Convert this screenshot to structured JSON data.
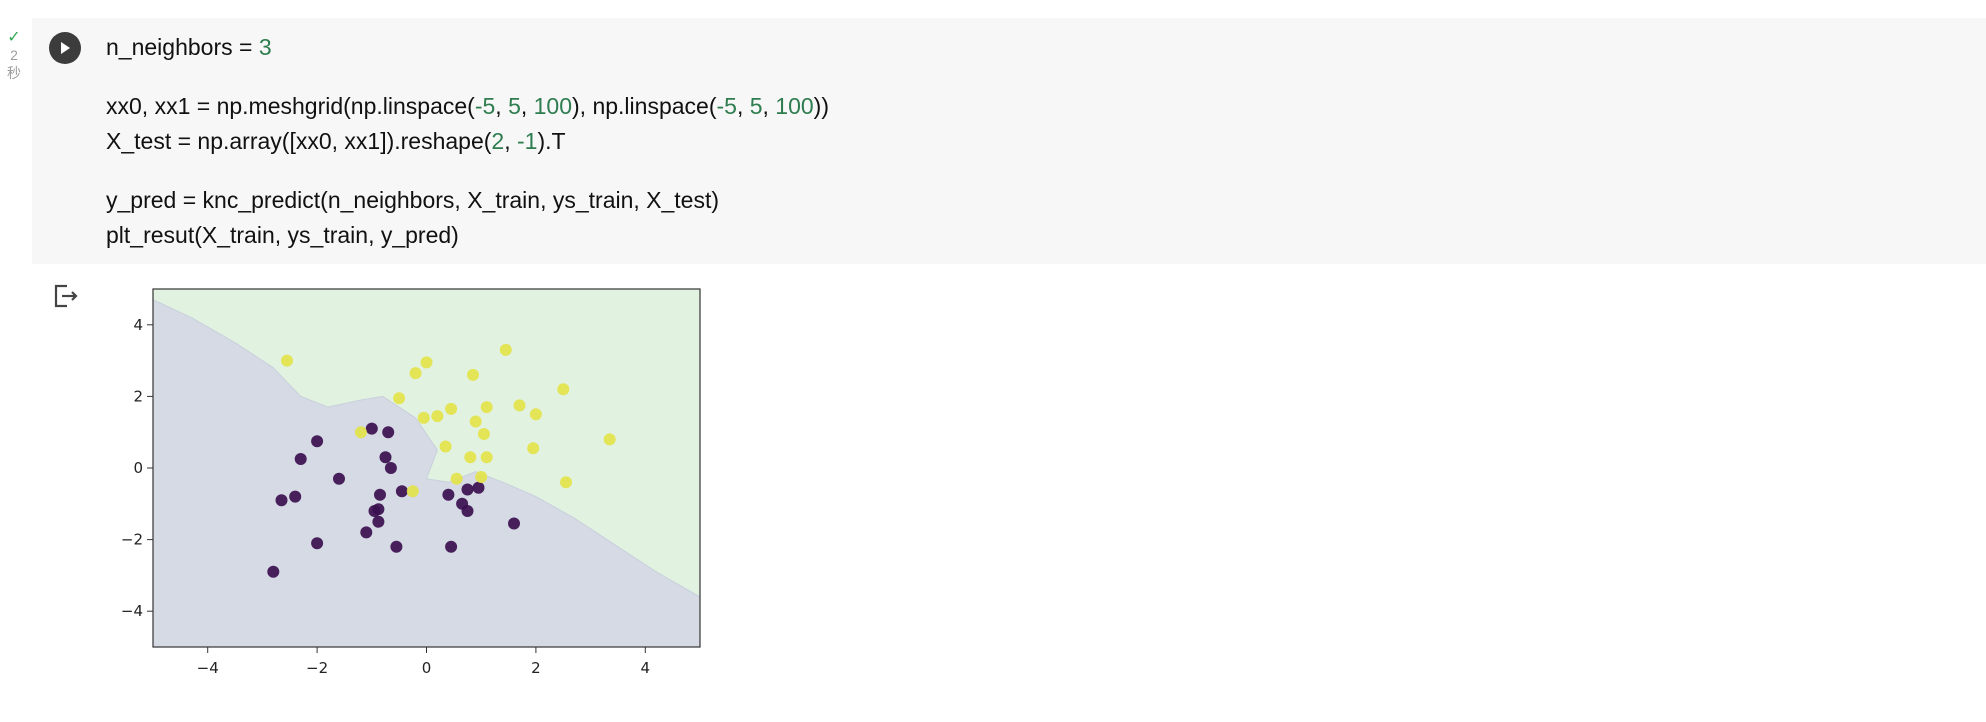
{
  "gutter": {
    "status_icon": "check-icon",
    "duration_value": "2",
    "duration_unit": "秒"
  },
  "cell": {
    "run_icon": "play-icon",
    "code_lines": [
      [
        {
          "t": "n_neighbors = "
        },
        {
          "t": "3",
          "n": true
        }
      ],
      [
        {
          "t": "xx0, xx1 = np.meshgrid(np.linspace("
        },
        {
          "t": "-5",
          "n": true
        },
        {
          "t": ", "
        },
        {
          "t": "5",
          "n": true
        },
        {
          "t": ", "
        },
        {
          "t": "100",
          "n": true
        },
        {
          "t": "), np.linspace("
        },
        {
          "t": "-5",
          "n": true
        },
        {
          "t": ", "
        },
        {
          "t": "5",
          "n": true
        },
        {
          "t": ", "
        },
        {
          "t": "100",
          "n": true
        },
        {
          "t": "))"
        }
      ],
      [
        {
          "t": "X_test = np.array([xx0, xx1]).reshape("
        },
        {
          "t": "2",
          "n": true
        },
        {
          "t": ", "
        },
        {
          "t": "-1",
          "n": true
        },
        {
          "t": ").T"
        }
      ],
      [
        {
          "t": "y_pred = knc_predict(n_neighbors, X_train, ys_train, X_test)"
        }
      ],
      [
        {
          "t": "plt_resut(X_train, ys_train, y_pred)"
        }
      ]
    ],
    "blank_after": [
      0,
      2
    ]
  },
  "output": {
    "icon": "output-redirect-icon"
  },
  "chart_data": {
    "type": "scatter",
    "xlim": [
      -5,
      5
    ],
    "ylim": [
      -5,
      5
    ],
    "xticks": [
      -4,
      -2,
      0,
      2,
      4
    ],
    "yticks": [
      -4,
      -2,
      0,
      2,
      4
    ],
    "xtick_labels": [
      "−4",
      "−2",
      "0",
      "2",
      "4"
    ],
    "ytick_labels": [
      "−4",
      "−2",
      "0",
      "2",
      "4"
    ],
    "grid": false,
    "background_regions": [
      {
        "class": 0,
        "color": "#d5dae5"
      },
      {
        "class": 1,
        "color": "#e2f2e0"
      }
    ],
    "boundary": [
      [
        -5,
        4.7
      ],
      [
        -4.3,
        4.2
      ],
      [
        -3.5,
        3.5
      ],
      [
        -2.8,
        2.8
      ],
      [
        -2.3,
        2.0
      ],
      [
        -1.8,
        1.7
      ],
      [
        -1.2,
        1.9
      ],
      [
        -0.8,
        2.0
      ],
      [
        -0.2,
        1.4
      ],
      [
        0.2,
        0.5
      ],
      [
        0.0,
        -0.3
      ],
      [
        0.4,
        -0.4
      ],
      [
        0.9,
        -0.1
      ],
      [
        1.4,
        -0.4
      ],
      [
        2.0,
        -0.8
      ],
      [
        2.7,
        -1.4
      ],
      [
        3.5,
        -2.2
      ],
      [
        4.2,
        -2.9
      ],
      [
        5,
        -3.6
      ]
    ],
    "series": [
      {
        "color": "#3b0f4f",
        "points": [
          [
            -2.8,
            -2.9
          ],
          [
            -2.65,
            -0.9
          ],
          [
            -2.4,
            -0.8
          ],
          [
            -2.3,
            0.25
          ],
          [
            -2.0,
            0.75
          ],
          [
            -2.0,
            -2.1
          ],
          [
            -1.6,
            -0.3
          ],
          [
            -1.1,
            -1.8
          ],
          [
            -1.0,
            1.1
          ],
          [
            -0.95,
            -1.2
          ],
          [
            -0.88,
            -1.15
          ],
          [
            -0.88,
            -1.5
          ],
          [
            -0.85,
            -0.75
          ],
          [
            -0.75,
            0.3
          ],
          [
            -0.7,
            1.0
          ],
          [
            -0.65,
            0.0
          ],
          [
            -0.55,
            -2.2
          ],
          [
            -0.45,
            -0.65
          ],
          [
            0.4,
            -0.75
          ],
          [
            0.45,
            -2.2
          ],
          [
            0.65,
            -1.0
          ],
          [
            0.75,
            -0.6
          ],
          [
            0.75,
            -1.2
          ],
          [
            0.95,
            -0.55
          ],
          [
            1.6,
            -1.55
          ]
        ]
      },
      {
        "color": "#e3e34a",
        "points": [
          [
            -2.55,
            3.0
          ],
          [
            -1.2,
            1.0
          ],
          [
            -0.5,
            1.95
          ],
          [
            -0.25,
            -0.65
          ],
          [
            -0.2,
            2.65
          ],
          [
            -0.05,
            1.4
          ],
          [
            0.0,
            2.95
          ],
          [
            0.2,
            1.45
          ],
          [
            0.35,
            0.6
          ],
          [
            0.45,
            1.65
          ],
          [
            0.55,
            -0.3
          ],
          [
            0.8,
            0.3
          ],
          [
            0.85,
            2.6
          ],
          [
            0.9,
            1.3
          ],
          [
            1.0,
            -0.25
          ],
          [
            1.05,
            0.95
          ],
          [
            1.1,
            0.3
          ],
          [
            1.1,
            1.7
          ],
          [
            1.45,
            3.3
          ],
          [
            1.7,
            1.75
          ],
          [
            1.95,
            0.55
          ],
          [
            2.0,
            1.5
          ],
          [
            2.5,
            2.2
          ],
          [
            2.55,
            -0.4
          ],
          [
            3.35,
            0.8
          ]
        ]
      }
    ]
  }
}
